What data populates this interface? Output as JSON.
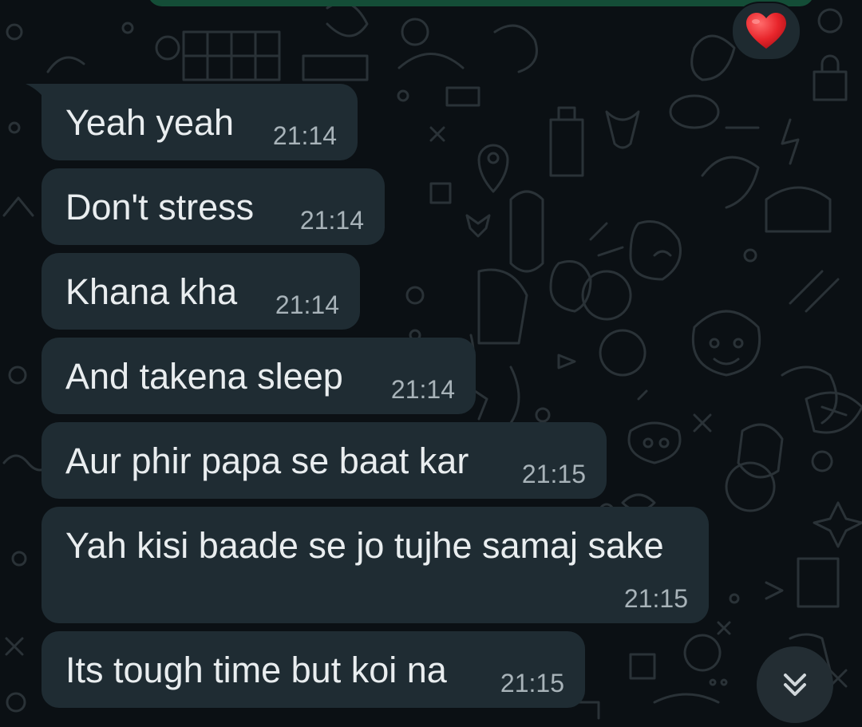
{
  "reaction": {
    "emoji": "❤️",
    "icon": "heart-icon"
  },
  "messages": [
    {
      "text": "Yeah yeah",
      "time": "21:14"
    },
    {
      "text": "Don't stress",
      "time": "21:14"
    },
    {
      "text": "Khana kha",
      "time": "21:14"
    },
    {
      "text": "And takena sleep",
      "time": "21:14"
    },
    {
      "text": "Aur phir papa se baat kar",
      "time": "21:15"
    },
    {
      "text": "Yah kisi baade se jo tujhe samaj sake",
      "time": "21:15"
    },
    {
      "text": "Its tough time but koi na",
      "time": "21:15"
    }
  ],
  "scroll_button": {
    "icon": "double-chevron-down-icon"
  },
  "colors": {
    "background": "#0b1014",
    "incoming_bubble": "#1f2c33",
    "outgoing_bubble": "#144d37",
    "text": "#e9edef",
    "timestamp": "#a8b3b9"
  }
}
